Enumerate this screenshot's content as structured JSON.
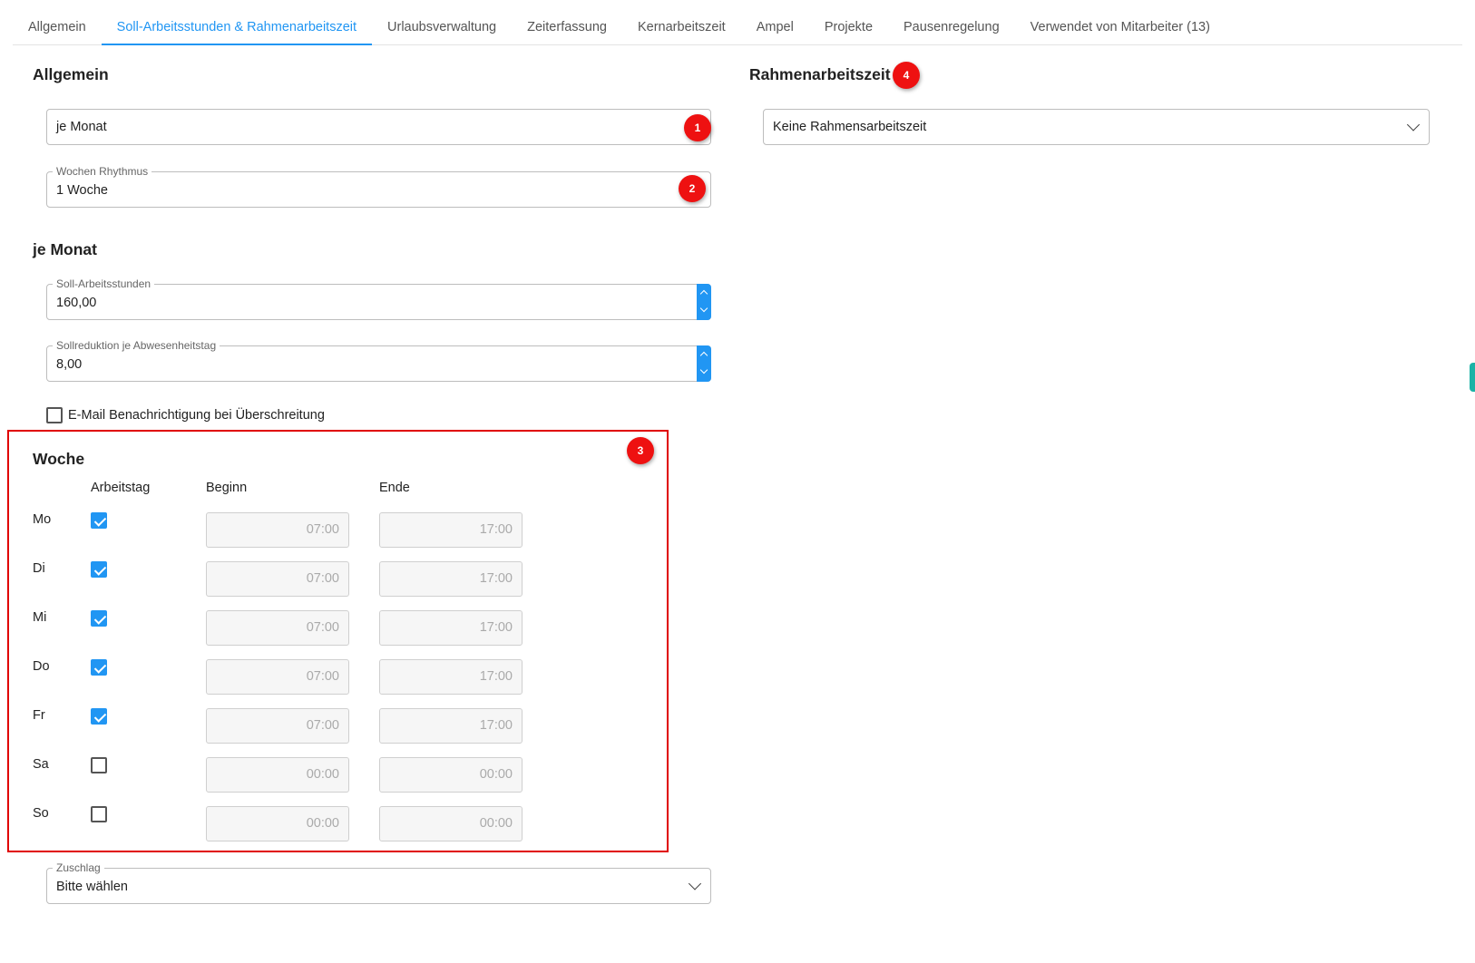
{
  "tabs": [
    {
      "label": "Allgemein",
      "active": false
    },
    {
      "label": "Soll-Arbeitsstunden & Rahmenarbeitszeit",
      "active": true
    },
    {
      "label": "Urlaubsverwaltung",
      "active": false
    },
    {
      "label": "Zeiterfassung",
      "active": false
    },
    {
      "label": "Kernarbeitszeit",
      "active": false
    },
    {
      "label": "Ampel",
      "active": false
    },
    {
      "label": "Projekte",
      "active": false
    },
    {
      "label": "Pausenregelung",
      "active": false
    },
    {
      "label": "Verwendet von Mitarbeiter (13)",
      "active": false
    }
  ],
  "allgemein": {
    "heading": "Allgemein",
    "period_value": "je Monat",
    "rhythm_label": "Wochen Rhythmus",
    "rhythm_value": "1 Woche"
  },
  "je_monat": {
    "heading": "je Monat",
    "soll_label": "Soll-Arbeitsstunden",
    "soll_value": "160,00",
    "reduction_label": "Sollreduktion je Abwesenheitstag",
    "reduction_value": "8,00",
    "email_checkbox_label": "E-Mail Benachrichtigung bei Überschreitung",
    "email_checked": false
  },
  "woche": {
    "heading": "Woche",
    "col_arbeitstag": "Arbeitstag",
    "col_beginn": "Beginn",
    "col_ende": "Ende",
    "days": [
      {
        "day": "Mo",
        "workday": true,
        "start": "07:00",
        "end": "17:00"
      },
      {
        "day": "Di",
        "workday": true,
        "start": "07:00",
        "end": "17:00"
      },
      {
        "day": "Mi",
        "workday": true,
        "start": "07:00",
        "end": "17:00"
      },
      {
        "day": "Do",
        "workday": true,
        "start": "07:00",
        "end": "17:00"
      },
      {
        "day": "Fr",
        "workday": true,
        "start": "07:00",
        "end": "17:00"
      },
      {
        "day": "Sa",
        "workday": false,
        "start": "00:00",
        "end": "00:00"
      },
      {
        "day": "So",
        "workday": false,
        "start": "00:00",
        "end": "00:00"
      }
    ]
  },
  "zuschlag": {
    "label": "Zuschlag",
    "value": "Bitte wählen"
  },
  "rahmen": {
    "heading": "Rahmenarbeitszeit",
    "value": "Keine Rahmensarbeitszeit"
  },
  "badges": [
    "1",
    "2",
    "3",
    "4"
  ],
  "colors": {
    "accent": "#2196f3",
    "badge": "#ee1111",
    "highlight_box": "#e00000"
  }
}
